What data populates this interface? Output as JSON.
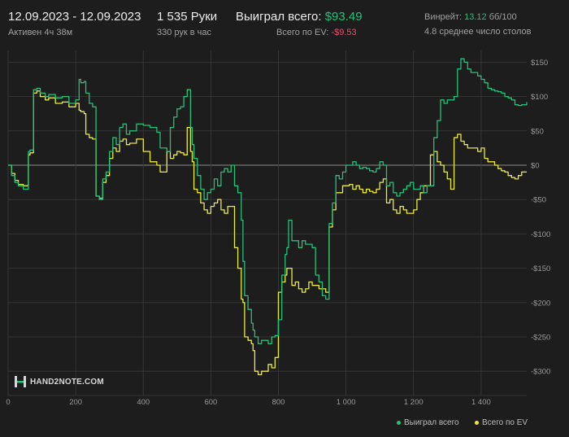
{
  "header": {
    "date_range": "12.09.2023 - 12.09.2023",
    "active": "Активен 4ч 38м",
    "hands": "1 535 Руки",
    "hands_per_hour": "330 рук в час",
    "won_label": "Выиграл всего:",
    "won_value": "$93.49",
    "ev_label": "Всего по EV:",
    "ev_value": "-$9.53",
    "winrate_label": "Винрейт:",
    "winrate_value": "13.12",
    "winrate_unit": "бб/100",
    "tables": "4.8 среднее число столов"
  },
  "logo": "HAND2NOTE.COM",
  "colors": {
    "won": "#25c07a",
    "ev": "#ecec3a",
    "negative": "#e0506e",
    "grid": "#3a3a3a",
    "zero": "#8a8a8a"
  },
  "chart_data": {
    "type": "line",
    "xlim": [
      0,
      1535
    ],
    "ylim": [
      -315,
      160
    ],
    "x_ticks": [
      0,
      200,
      400,
      600,
      800,
      1000,
      1200,
      1400
    ],
    "x_tick_labels": [
      "0",
      "200",
      "400",
      "600",
      "800",
      "1 000",
      "1 200",
      "1 400"
    ],
    "y_ticks": [
      150,
      100,
      50,
      0,
      -50,
      -100,
      -150,
      -200,
      -250,
      -300
    ],
    "y_tick_labels": [
      "$150",
      "$100",
      "$50",
      "$0",
      "-$50",
      "-$100",
      "-$150",
      "-$200",
      "-$250",
      "-$300"
    ],
    "legend": "bottom-right",
    "series": [
      {
        "name": "Выиграл всего",
        "color": "#25c07a",
        "x": [
          0,
          10,
          20,
          30,
          45,
          60,
          65,
          75,
          85,
          95,
          110,
          120,
          140,
          160,
          180,
          200,
          210,
          215,
          225,
          230,
          240,
          250,
          260,
          270,
          280,
          290,
          300,
          310,
          320,
          330,
          340,
          350,
          360,
          380,
          400,
          420,
          440,
          450,
          470,
          480,
          490,
          500,
          510,
          520,
          530,
          540,
          545,
          550,
          560,
          570,
          580,
          590,
          600,
          610,
          620,
          630,
          640,
          650,
          660,
          670,
          680,
          690,
          695,
          700,
          710,
          720,
          725,
          730,
          740,
          750,
          760,
          770,
          780,
          790,
          800,
          810,
          820,
          825,
          830,
          840,
          850,
          860,
          870,
          880,
          890,
          900,
          910,
          920,
          930,
          940,
          950,
          960,
          970,
          980,
          990,
          1000,
          1010,
          1020,
          1030,
          1040,
          1050,
          1060,
          1070,
          1080,
          1090,
          1100,
          1110,
          1120,
          1130,
          1140,
          1150,
          1160,
          1170,
          1180,
          1190,
          1200,
          1210,
          1220,
          1230,
          1240,
          1250,
          1260,
          1270,
          1280,
          1290,
          1300,
          1310,
          1320,
          1330,
          1340,
          1350,
          1360,
          1370,
          1380,
          1390,
          1400,
          1410,
          1420,
          1430,
          1440,
          1450,
          1460,
          1470,
          1480,
          1490,
          1500,
          1510,
          1520,
          1535
        ],
        "y": [
          0,
          -15,
          -25,
          -30,
          -35,
          20,
          22,
          110,
          112,
          105,
          100,
          103,
          98,
          100,
          90,
          95,
          125,
          120,
          122,
          105,
          90,
          85,
          -45,
          -50,
          -20,
          -10,
          20,
          40,
          30,
          55,
          60,
          45,
          50,
          60,
          58,
          55,
          48,
          25,
          20,
          55,
          70,
          82,
          85,
          100,
          110,
          55,
          30,
          10,
          -15,
          -35,
          -50,
          -40,
          -35,
          -20,
          -30,
          -10,
          -5,
          -10,
          0,
          -30,
          -40,
          -80,
          -140,
          -190,
          -210,
          -230,
          -240,
          -250,
          -260,
          -255,
          -255,
          -260,
          -250,
          -248,
          -225,
          -160,
          -130,
          -120,
          -80,
          -110,
          -110,
          -120,
          -110,
          -115,
          -115,
          -120,
          -160,
          -170,
          -190,
          -195,
          -85,
          -55,
          -15,
          -20,
          -10,
          0,
          0,
          5,
          0,
          -5,
          -3,
          -5,
          -8,
          -10,
          -5,
          5,
          0,
          -30,
          -25,
          -40,
          -45,
          -40,
          -35,
          -30,
          -25,
          -35,
          -35,
          -30,
          -40,
          -30,
          -30,
          40,
          65,
          95,
          90,
          95,
          95,
          100,
          140,
          155,
          150,
          140,
          135,
          135,
          130,
          125,
          120,
          112,
          110,
          108,
          107,
          105,
          100,
          98,
          95,
          88,
          87,
          88,
          92
        ]
      },
      {
        "name": "Всего по EV",
        "color": "#ecec3a",
        "x": [
          0,
          10,
          20,
          30,
          45,
          60,
          65,
          75,
          85,
          95,
          110,
          120,
          140,
          160,
          180,
          200,
          210,
          215,
          225,
          230,
          240,
          250,
          260,
          270,
          280,
          290,
          300,
          310,
          320,
          330,
          340,
          350,
          360,
          380,
          400,
          420,
          440,
          450,
          470,
          480,
          490,
          500,
          510,
          520,
          530,
          540,
          545,
          550,
          560,
          570,
          580,
          590,
          600,
          610,
          620,
          630,
          640,
          650,
          660,
          670,
          680,
          690,
          695,
          700,
          710,
          720,
          725,
          730,
          740,
          750,
          760,
          770,
          780,
          790,
          800,
          810,
          820,
          825,
          830,
          840,
          850,
          860,
          870,
          880,
          890,
          900,
          910,
          920,
          930,
          940,
          950,
          960,
          970,
          980,
          990,
          1000,
          1010,
          1020,
          1030,
          1040,
          1050,
          1060,
          1070,
          1080,
          1090,
          1100,
          1110,
          1120,
          1130,
          1140,
          1150,
          1160,
          1170,
          1180,
          1190,
          1200,
          1210,
          1220,
          1230,
          1240,
          1250,
          1260,
          1270,
          1280,
          1290,
          1300,
          1310,
          1320,
          1330,
          1340,
          1350,
          1360,
          1370,
          1380,
          1390,
          1400,
          1410,
          1420,
          1430,
          1440,
          1450,
          1460,
          1470,
          1480,
          1490,
          1500,
          1510,
          1520,
          1535
        ],
        "y": [
          0,
          -12,
          -22,
          -28,
          -30,
          15,
          18,
          105,
          108,
          100,
          95,
          98,
          90,
          92,
          85,
          90,
          80,
          78,
          75,
          45,
          40,
          38,
          -45,
          -48,
          -25,
          -15,
          10,
          25,
          20,
          35,
          38,
          30,
          32,
          38,
          20,
          5,
          0,
          -10,
          20,
          10,
          15,
          20,
          18,
          15,
          55,
          20,
          5,
          -35,
          -40,
          -55,
          -65,
          -70,
          -60,
          -55,
          -50,
          -65,
          -70,
          -60,
          -60,
          -120,
          -150,
          -195,
          -200,
          -250,
          -255,
          -260,
          -270,
          -300,
          -305,
          -300,
          -300,
          -290,
          -295,
          -280,
          -185,
          -170,
          -160,
          -150,
          -150,
          -175,
          -170,
          -180,
          -185,
          -180,
          -170,
          -175,
          -175,
          -180,
          -180,
          -185,
          -90,
          -65,
          -40,
          -40,
          -30,
          -30,
          -28,
          -35,
          -30,
          -35,
          -40,
          -35,
          -38,
          -40,
          -35,
          -25,
          -20,
          -55,
          -50,
          -65,
          -70,
          -60,
          -65,
          -70,
          -70,
          -65,
          -50,
          -40,
          -30,
          -30,
          15,
          20,
          5,
          0,
          -10,
          -20,
          -35,
          40,
          45,
          35,
          30,
          25,
          25,
          25,
          20,
          25,
          10,
          5,
          5,
          0,
          -5,
          -8,
          -10,
          -15,
          -18,
          -20,
          -15,
          -10,
          -10
        ]
      }
    ]
  }
}
